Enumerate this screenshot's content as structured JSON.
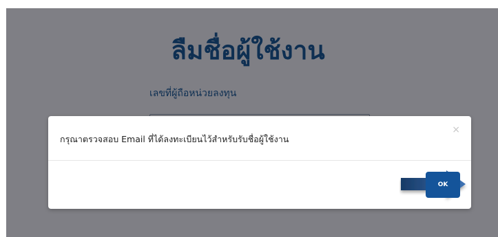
{
  "page": {
    "title": "ลืมชื่อผู้ใช้งาน",
    "field_label": "เลขที่ผู้ถือหน่วยลงทุน",
    "field_value": ""
  },
  "modal": {
    "message": "กรุณาตรวจสอบ Email ที่ได้ลงทะเบียนไว้สำหรับรับชื่อผู้ใช้งาน",
    "close_symbol": "×",
    "ok_label": "OK"
  },
  "colors": {
    "backdrop": "#7f7f85",
    "title": "#0e2f52",
    "ok_button": "#14549a",
    "arrow": "#2d5f9e"
  },
  "icons": {
    "close": "close-icon",
    "pointer": "arrow-right-icon"
  }
}
